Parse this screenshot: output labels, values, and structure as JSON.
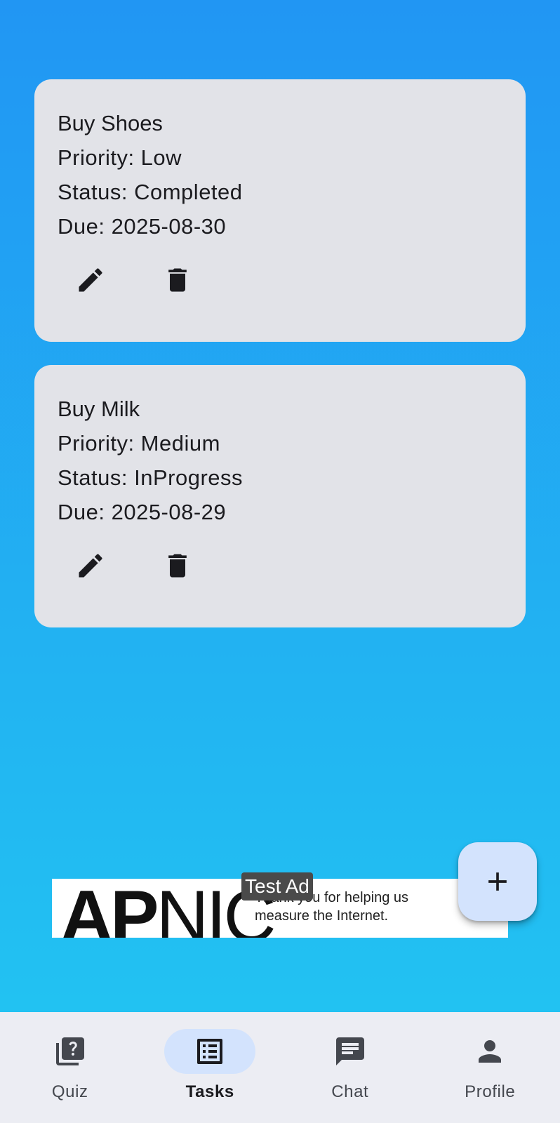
{
  "tasks": [
    {
      "title": "Buy Shoes",
      "priority": "Priority: Low",
      "status": "Status: Completed",
      "due": "Due: 2025-08-30"
    },
    {
      "title": "Buy Milk",
      "priority": "Priority: Medium",
      "status": "Status: InProgress",
      "due": "Due: 2025-08-29"
    }
  ],
  "ad": {
    "tag": "Test Ad",
    "logo_bold": "AP",
    "logo_thin": "NIC",
    "text": "Thank you for helping us measure the Internet."
  },
  "fab": {
    "icon": "plus-icon"
  },
  "nav": {
    "items": [
      {
        "label": "Quiz",
        "icon": "quiz-icon",
        "active": false
      },
      {
        "label": "Tasks",
        "icon": "list-icon",
        "active": true
      },
      {
        "label": "Chat",
        "icon": "chat-icon",
        "active": false
      },
      {
        "label": "Profile",
        "icon": "person-icon",
        "active": false
      }
    ]
  },
  "colors": {
    "background_top": "#2196F3",
    "background_bottom": "#22C7F2",
    "card": "#E2E3E8",
    "nav_bar": "#ECEDF3",
    "active_pill": "#D3E3FD"
  }
}
